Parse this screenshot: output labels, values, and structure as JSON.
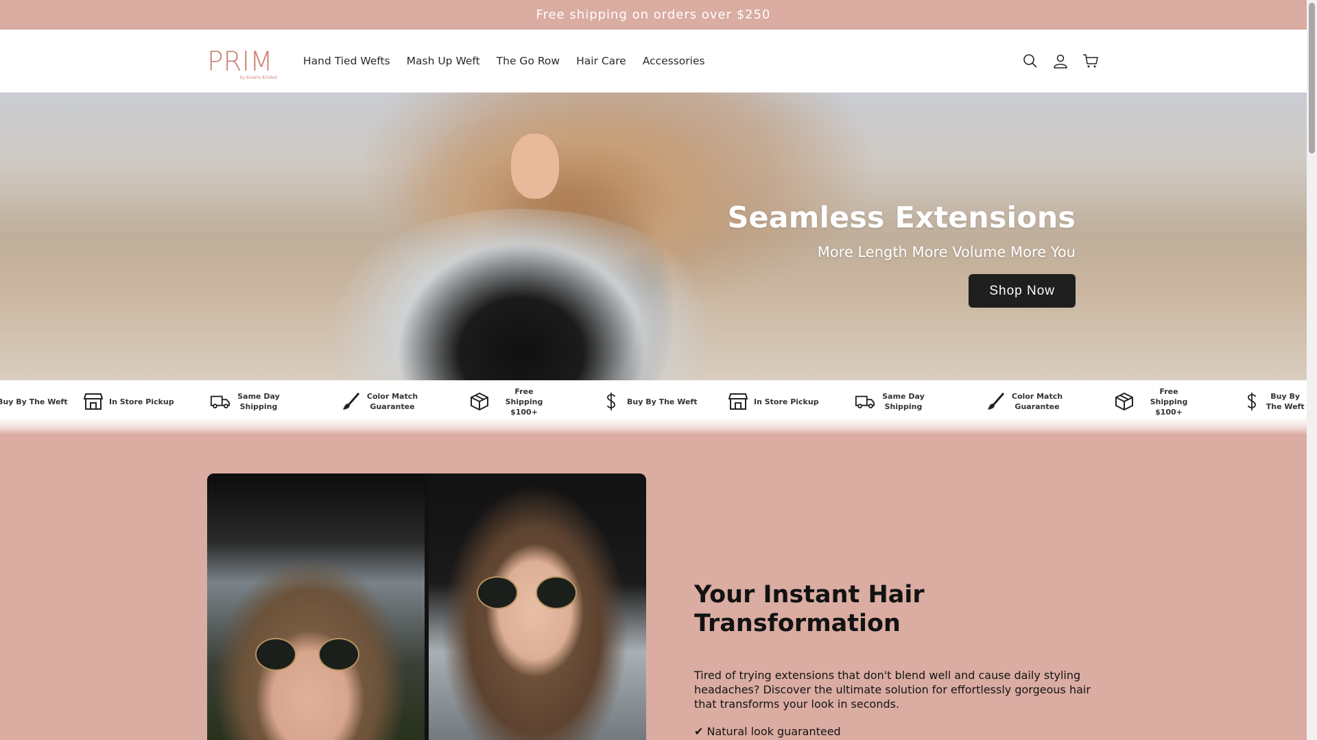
{
  "announcement": "Free shipping on orders over $250",
  "logo": {
    "text": "PRIM",
    "sub": "by Sandra Krishel"
  },
  "nav": [
    "Hand Tied Wefts",
    "Mash Up Weft",
    "The Go Row",
    "Hair Care",
    "Accessories"
  ],
  "header_icons": [
    "search-icon",
    "account-icon",
    "cart-icon"
  ],
  "hero": {
    "title": "Seamless Extensions",
    "subtitle": "More Length More Volume More You",
    "button": "Shop Now"
  },
  "marquee": [
    {
      "icon": "dollar-icon",
      "label": "Buy By The Weft"
    },
    {
      "icon": "store-icon",
      "label": "In Store Pickup"
    },
    {
      "icon": "truck-icon",
      "label": "Same Day Shipping"
    },
    {
      "icon": "brush-icon",
      "label": "Color Match Guarantee"
    },
    {
      "icon": "box-icon",
      "label": "Free Shipping $100+"
    },
    {
      "icon": "dollar-icon",
      "label": "Buy By The Weft"
    },
    {
      "icon": "store-icon",
      "label": "In Store Pickup"
    },
    {
      "icon": "truck-icon",
      "label": "Same Day Shipping"
    },
    {
      "icon": "brush-icon",
      "label": "Color Match Guarantee"
    },
    {
      "icon": "box-icon",
      "label": "Free Shipping $100+"
    },
    {
      "icon": "dollar-icon",
      "label": "Buy By The Weft"
    }
  ],
  "feature": {
    "title": "Your Instant Hair Transformation",
    "body": "Tired of trying extensions that don't blend well and cause daily styling headaches? Discover the ultimate solution for effortlessly gorgeous hair that transforms your look in seconds.",
    "bullet": "✔ Natural look guaranteed"
  },
  "colors": {
    "brand": "#daaca2",
    "logo": "#cc7f72",
    "button": "#1f1f1f"
  }
}
